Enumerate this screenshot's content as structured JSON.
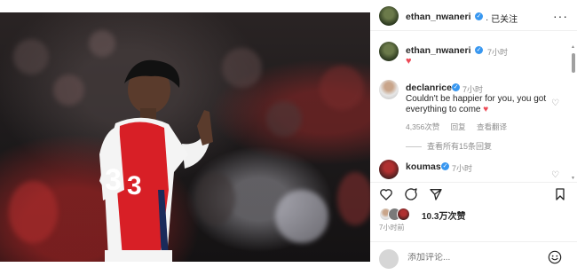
{
  "post": {
    "photo_alt": "",
    "header": {
      "username": "ethan_nwaneri",
      "follow_status": "· 已关注",
      "more_icon": "more-horizontal-icon"
    },
    "caption": {
      "username": "ethan_nwaneri",
      "time": "7小时",
      "heart": "♥"
    },
    "comments": [
      {
        "username": "declanrice",
        "time": "7小时",
        "text": "Couldn't be happier for you, you got everything to come",
        "heart": "♥",
        "likes": "4,356次赞",
        "reply": "回复",
        "translate": "查看翻译",
        "view_replies": "查看所有15条回复"
      },
      {
        "username": "koumas",
        "time": "7小时"
      }
    ],
    "likes": "10.3万次赞",
    "posted_ago": "7小时前",
    "add_comment_placeholder": "添加评论...",
    "colors": {
      "verified": "#3897f0",
      "heart": "#ed4956",
      "jersey_red": "#d81f26"
    }
  }
}
